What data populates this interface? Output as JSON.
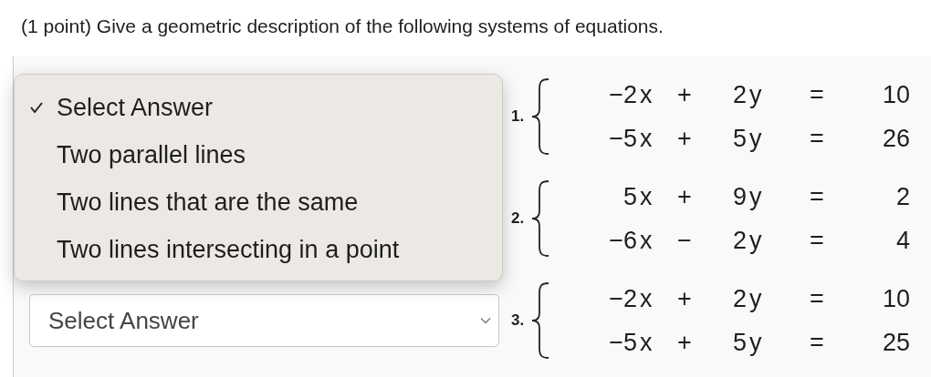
{
  "title": "(1 point) Give a geometric description of the following systems of equations.",
  "open_menu": {
    "options": [
      {
        "label": "Select Answer",
        "selected": true
      },
      {
        "label": "Two parallel lines",
        "selected": false
      },
      {
        "label": "Two lines that are the same",
        "selected": false
      },
      {
        "label": "Two lines intersecting in a point",
        "selected": false
      }
    ]
  },
  "systems": [
    {
      "number": "1.",
      "equations": [
        {
          "x_coef": "−2",
          "x_var": "x",
          "op": "+",
          "y_coef": "2",
          "y_var": "y",
          "eq": "=",
          "rhs": "10"
        },
        {
          "x_coef": "−5",
          "x_var": "x",
          "op": "+",
          "y_coef": "5",
          "y_var": "y",
          "eq": "=",
          "rhs": "26"
        }
      ]
    },
    {
      "number": "2.",
      "equations": [
        {
          "x_coef": "5",
          "x_var": "x",
          "op": "+",
          "y_coef": "9",
          "y_var": "y",
          "eq": "=",
          "rhs": "2"
        },
        {
          "x_coef": "−6",
          "x_var": "x",
          "op": "−",
          "y_coef": "2",
          "y_var": "y",
          "eq": "=",
          "rhs": "4"
        }
      ]
    },
    {
      "number": "3.",
      "select": {
        "value": "Select Answer"
      },
      "equations": [
        {
          "x_coef": "−2",
          "x_var": "x",
          "op": "+",
          "y_coef": "2",
          "y_var": "y",
          "eq": "=",
          "rhs": "10"
        },
        {
          "x_coef": "−5",
          "x_var": "x",
          "op": "+",
          "y_coef": "5",
          "y_var": "y",
          "eq": "=",
          "rhs": "25"
        }
      ]
    }
  ]
}
